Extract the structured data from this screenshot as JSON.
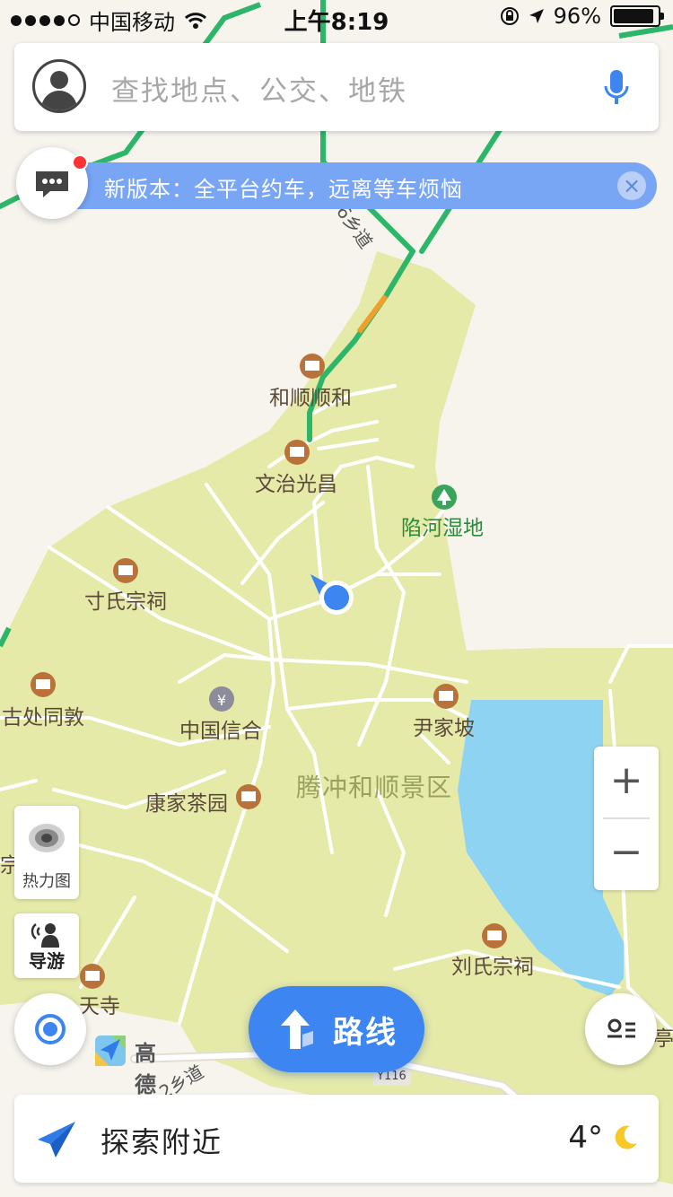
{
  "status_bar": {
    "carrier": "中国移动",
    "time": "上午8:19",
    "battery": "96%",
    "battery_level": 0.96
  },
  "search": {
    "placeholder": "查找地点、公交、地铁"
  },
  "banner": {
    "text": "新版本：全平台约车，远离等车烦恼"
  },
  "map": {
    "area_name": "腾冲和顺景区",
    "poi": [
      {
        "name": "和顺顺和",
        "type": "landmark"
      },
      {
        "name": "文治光昌",
        "type": "landmark"
      },
      {
        "name": "陷河湿地",
        "type": "park"
      },
      {
        "name": "寸氏宗祠",
        "type": "landmark"
      },
      {
        "name": "古处同敦",
        "type": "landmark"
      },
      {
        "name": "中国信合",
        "type": "bank"
      },
      {
        "name": "尹家坡",
        "type": "landmark"
      },
      {
        "name": "康家茶园",
        "type": "landmark"
      },
      {
        "name": "刘氏宗祠",
        "type": "temple"
      },
      {
        "name": "天寺",
        "type": "landmark"
      },
      {
        "name": "宗祠",
        "type": "landmark"
      },
      {
        "name": "亭",
        "type": "landmark"
      }
    ],
    "road_labels": [
      "6乡道",
      "2乡道",
      "Y116"
    ]
  },
  "controls": {
    "heatmap_label": "热力图",
    "guide_label": "导游",
    "zoom_in": "+",
    "zoom_out": "−",
    "route_label": "路线"
  },
  "brand": {
    "name": "高德地图"
  },
  "bottom": {
    "explore_label": "探索附近",
    "temperature": "4°",
    "weather_icon": "moon-icon"
  },
  "colors": {
    "land": "#e6eaa9",
    "water": "#8fd3f3",
    "accent": "#3d85f0",
    "highway": "#2db56a",
    "banner": "#78a6f5"
  }
}
